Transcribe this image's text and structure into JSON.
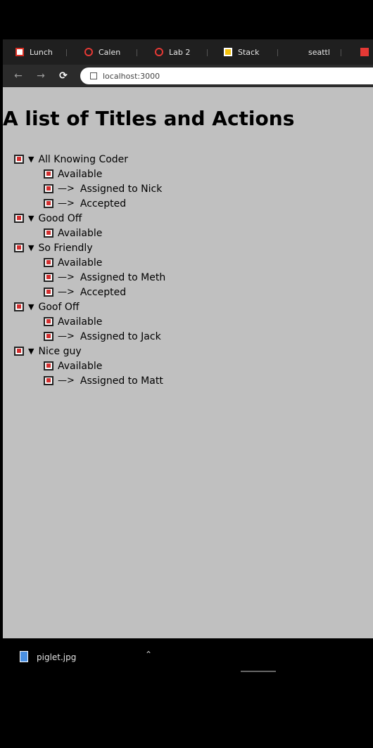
{
  "browser": {
    "tabs": [
      {
        "label": "Lunch",
        "icon": "gmail-icon"
      },
      {
        "label": "Calen",
        "icon": "calendar-icon"
      },
      {
        "label": "Lab 2",
        "icon": "lab-icon"
      },
      {
        "label": "Stack",
        "icon": "stack-icon"
      },
      {
        "label": "seattl",
        "icon": ""
      },
      {
        "label": "",
        "icon": "red-app-icon"
      }
    ],
    "address": "localhost:3000"
  },
  "page": {
    "heading": "A list of Titles and Actions",
    "titles": [
      {
        "name": "All Knowing Coder",
        "actions": [
          {
            "arrow": "",
            "text": "Available"
          },
          {
            "arrow": "—>",
            "text": "Assigned to Nick"
          },
          {
            "arrow": "—>",
            "text": "Accepted"
          }
        ]
      },
      {
        "name": "Good Off",
        "actions": [
          {
            "arrow": "",
            "text": "Available"
          }
        ]
      },
      {
        "name": "So Friendly",
        "actions": [
          {
            "arrow": "",
            "text": "Available"
          },
          {
            "arrow": "—>",
            "text": "Assigned to Meth"
          },
          {
            "arrow": "—>",
            "text": "Accepted"
          }
        ]
      },
      {
        "name": "Goof Off",
        "actions": [
          {
            "arrow": "",
            "text": "Available"
          },
          {
            "arrow": "—>",
            "text": "Assigned to Jack"
          }
        ]
      },
      {
        "name": "Nice guy",
        "actions": [
          {
            "arrow": "",
            "text": "Available"
          },
          {
            "arrow": "—>",
            "text": "Assigned to Matt"
          }
        ]
      }
    ]
  },
  "downloads": {
    "file_name": "piglet.jpg"
  }
}
